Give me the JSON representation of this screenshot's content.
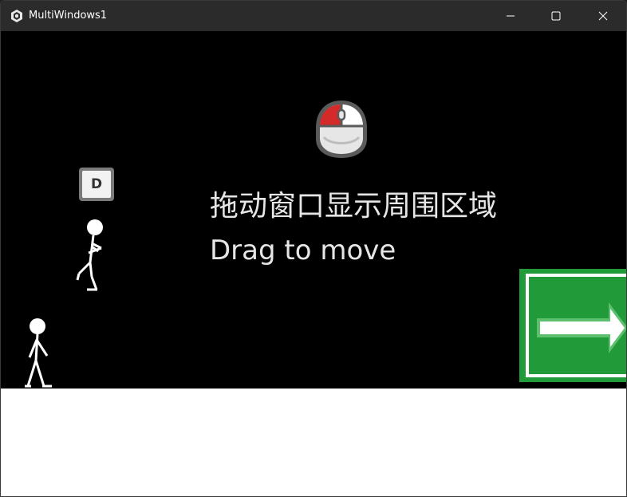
{
  "window": {
    "title": "MultiWindows1",
    "controls": {
      "minimize": "minimize",
      "maximize": "maximize",
      "close": "close"
    }
  },
  "game": {
    "key_hint": "D",
    "instruction_cn": "拖动窗口显示周围区域",
    "instruction_en": "Drag to move",
    "icons": [
      "mouse-left-click-icon",
      "key-d-icon",
      "exit-arrow-sign"
    ],
    "colors": {
      "background": "#000000",
      "ground": "#ffffff",
      "exit_green": "#219a3a",
      "mouse_red": "#d42a2a"
    }
  }
}
